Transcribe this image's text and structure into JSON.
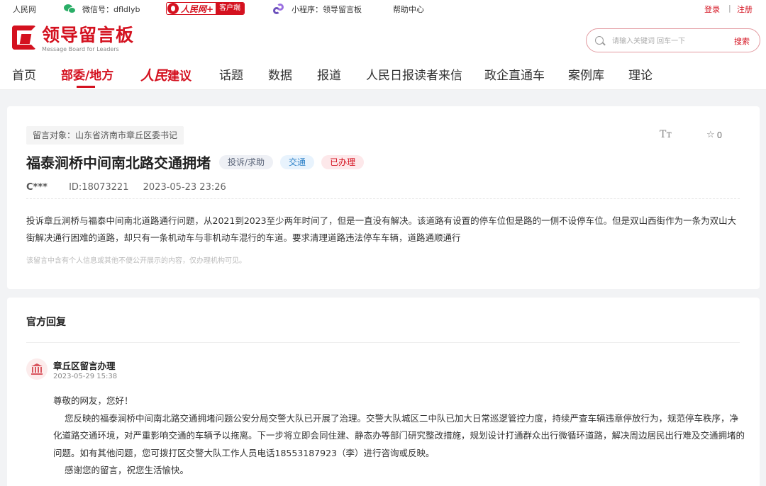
{
  "topbar": {
    "site": "人民网",
    "wechat": "微信号：dfldlyb",
    "client_name": "人民网+",
    "client_tag": "客户端",
    "mini_program": "小程序：领导留言板",
    "help": "帮助中心",
    "login": "登录",
    "separator": "|",
    "register": "注册"
  },
  "logo": {
    "cn": "领导留言板",
    "en": "Message Board for Leaders"
  },
  "search": {
    "placeholder": "请输入关键词 回车一下",
    "button": "搜索"
  },
  "nav": {
    "items": [
      "首页",
      "部委/地方",
      "人民建议",
      "话题",
      "数据",
      "报道",
      "人民日报读者来信",
      "政企直通车",
      "案例库",
      "理论"
    ],
    "jianyi_a": "人民",
    "jianyi_b": "建议",
    "active": "部委/地方"
  },
  "message": {
    "target": "留言对象：山东省济南市章丘区委书记",
    "font_toggle": "Tт",
    "fav_count": "0",
    "title": "福泰涧桥中间南北路交通拥堵",
    "badges": {
      "type": "投诉/求助",
      "category": "交通",
      "status": "已办理"
    },
    "author": "C***",
    "id": "ID:18073221",
    "time": "2023-05-23 23:26",
    "content": "投诉章丘涧桥与福泰中间南北道路通行问题，从2021到2023至少两年时间了，但是一直没有解决。该道路有设置的停车位但是路的一侧不设停车位。但是双山西街作为一条为双山大街解决通行困难的道路，却只有一条机动车与非机动车混行的车道。要求清理道路违法停车车辆，道路通顺通行",
    "notice": "该留言中含有个人信息或其他不便公开展示的内容，仅办理机构可见。"
  },
  "reply": {
    "title": "官方回复",
    "dept": "章丘区留言办理",
    "time": "2023-05-29 15:38",
    "greeting": "尊敬的网友，您好！",
    "body": "您反映的福泰涧桥中间南北路交通拥堵问题公安分局交警大队已开展了治理。交警大队城区二中队已加大日常巡逻管控力度，持续严查车辆违章停放行为，规范停车秩序，净化道路交通环境，对严重影响交通的车辆予以拖离。下一步将立即会同住建、静态办等部门研究整改措施，规划设计打通群众出行微循环道路，解决周边居民出行难及交通拥堵的问题。如有其他问题，您可拨打区交警大队工作人员电话18553187923（李）进行咨询或反映。",
    "closing": "感谢您的留言，祝您生活愉快。"
  },
  "colors": {
    "brand_red": "#d4111f",
    "page_bg": "#f2f3f5"
  }
}
